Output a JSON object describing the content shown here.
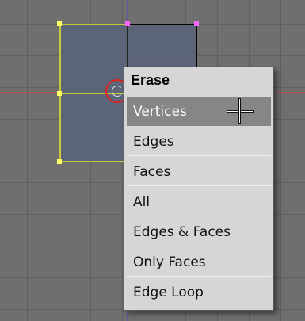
{
  "colors": {
    "viewport_bg": "#6f6f6f",
    "grid": "#5f5f5f",
    "face": "#5c6577",
    "selected_vertex": "#ffff66",
    "selected_edge": "#c8c83a",
    "unselected_vertex": "#ff66ff",
    "edge": "#000000",
    "menu_bg": "#d6d6d6",
    "menu_highlight": "#868686"
  },
  "menu": {
    "title": "Erase",
    "items": [
      {
        "label": "Vertices",
        "highlighted": true
      },
      {
        "label": "Edges",
        "highlighted": false
      },
      {
        "label": "Faces",
        "highlighted": false
      },
      {
        "label": "All",
        "highlighted": false
      },
      {
        "label": "Edges & Faces",
        "highlighted": false
      },
      {
        "label": "Only Faces",
        "highlighted": false
      },
      {
        "label": "Edge Loop",
        "highlighted": false
      }
    ]
  },
  "icons": {
    "cursor": "crosshair-cursor-icon",
    "3d_cursor": "3d-cursor-icon"
  }
}
